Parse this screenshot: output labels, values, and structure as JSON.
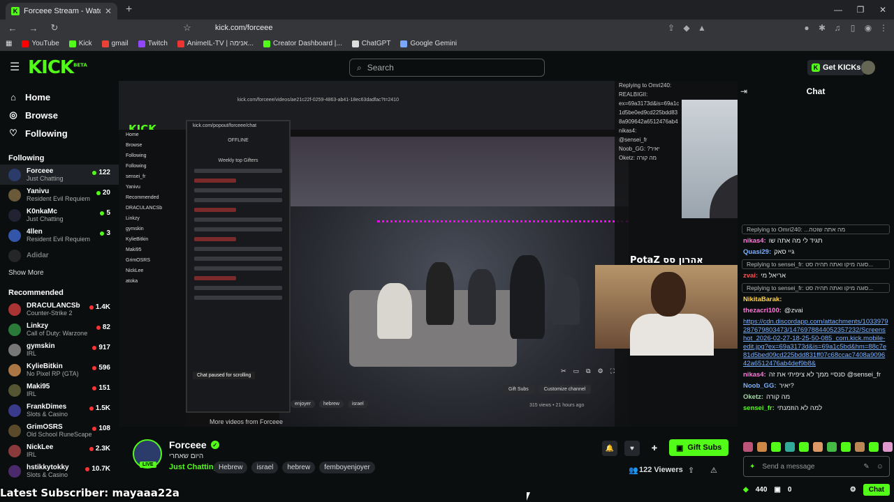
{
  "browser": {
    "tab_title": "Forceee Stream - Watch Live",
    "url": "kick.com/forceee",
    "bookmarks": [
      {
        "label": "YouTube",
        "color": "#f00"
      },
      {
        "label": "Kick",
        "color": "#53fc18"
      },
      {
        "label": "gmail",
        "color": "#ea4335"
      },
      {
        "label": "Twitch",
        "color": "#9146ff"
      },
      {
        "label": "AnimeIL-TV | אנימה...",
        "color": "#e33"
      },
      {
        "label": "Creator Dashboard |...",
        "color": "#53fc18"
      },
      {
        "label": "ChatGPT",
        "color": "#ddd"
      },
      {
        "label": "Google Gemini",
        "color": "#7aa7ff"
      }
    ]
  },
  "header": {
    "logo": "KICK",
    "logo_sup": "BETA",
    "search_placeholder": "Search",
    "get_kicks": "Get KICKs"
  },
  "sidebar": {
    "nav": [
      {
        "label": "Home",
        "icon": "home-icon"
      },
      {
        "label": "Browse",
        "icon": "compass-icon"
      },
      {
        "label": "Following",
        "icon": "heart-icon"
      }
    ],
    "following_title": "Following",
    "following": [
      {
        "name": "Forceee",
        "category": "Just Chatting",
        "viewers": "122",
        "color": "#2b3c6a",
        "selected": true
      },
      {
        "name": "Yanivu",
        "category": "Resident Evil Requiem",
        "viewers": "20",
        "color": "#6a5a3a"
      },
      {
        "name": "K0nkaMc",
        "category": "Just Chatting",
        "viewers": "5",
        "color": "#223"
      },
      {
        "name": "4llen",
        "category": "Resident Evil Requiem",
        "viewers": "3",
        "color": "#3355aa"
      },
      {
        "name": "Adidar",
        "category": "",
        "viewers": "",
        "color": "#444",
        "offline": true
      }
    ],
    "show_more": "Show More",
    "recommended_title": "Recommended",
    "recommended": [
      {
        "name": "DRACULANCSb",
        "category": "Counter-Strike 2",
        "viewers": "1.4K",
        "color": "#a33"
      },
      {
        "name": "Linkzy",
        "category": "Call of Duty: Warzone",
        "viewers": "82",
        "color": "#2a7a3a"
      },
      {
        "name": "gymskin",
        "category": "IRL",
        "viewers": "917",
        "color": "#777"
      },
      {
        "name": "KylieBitkin",
        "category": "No Pixel RP (GTA)",
        "viewers": "596",
        "color": "#aa7744"
      },
      {
        "name": "Maki95",
        "category": "IRL",
        "viewers": "151",
        "color": "#553"
      },
      {
        "name": "FrankDimes",
        "category": "Slots & Casino",
        "viewers": "1.5K",
        "color": "#3a3a8a"
      },
      {
        "name": "GrimOSRS",
        "category": "Old School RuneScape",
        "viewers": "108",
        "color": "#5a4a2a"
      },
      {
        "name": "NickLee",
        "category": "IRL",
        "viewers": "2.3K",
        "color": "#8a3a3a"
      },
      {
        "name": "hstikkytokky",
        "category": "Slots & Casino",
        "viewers": "10.7K",
        "color": "#4a2a6a"
      }
    ]
  },
  "video_inner": {
    "url": "kick.com/forceee/videos/ae21c22f-0259-4863-ab41-18ec63dadfac?t=2410",
    "popout_status": "OFFLINE",
    "weekly": "Weekly top Gifters",
    "paused": "Chat paused for scrolling",
    "overlay_name": "PotaZ אהרון סס",
    "gift_subs": "Gift Subs",
    "customize": "Customize channel",
    "meta": "315 views  •  21 hours ago",
    "more_videos": "More videos from Forceee",
    "tags": [
      "enjoyer",
      "hebrew",
      "israel"
    ]
  },
  "chat": {
    "title": "Chat",
    "messages": [
      {
        "type": "reply",
        "text": "Replying to Omri240: ...מה אתה שוטה"
      },
      {
        "type": "msg",
        "user": "nikas4:",
        "color": "#ff7ad9",
        "text": "תגיד לי מה אתה שו"
      },
      {
        "type": "msg",
        "user": "Quasi29:",
        "color": "#7bb0ff",
        "text": "גיי סאק"
      },
      {
        "type": "reply",
        "text": "Replying to sensei_fr: סוגה מיקו ואתה תהיה סט..."
      },
      {
        "type": "msg",
        "user": "zvai:",
        "color": "#ff5252",
        "text": "אריאל מי"
      },
      {
        "type": "reply",
        "text": "Replying to sensei_fr: סוגה מיקו ואתה תהיה סט..."
      },
      {
        "type": "msg",
        "user": "NikitaBarak:",
        "color": "#ffd54f",
        "text": ""
      },
      {
        "type": "msg",
        "user": "thezacri100:",
        "color": "#ff7ad9",
        "text": "@zvai"
      },
      {
        "type": "link",
        "text": "https://cdn.discordapp.com/attachments/1033979287679803473/1476978844052357232/Screenshot_2026-02-27-18-25-50-085_com.kick.mobile-edit.jpg?ex=69a3173d&is=69a1c5bd&hm=88c7e81d5bed09cd225bdd831ff07c68ccac7408a909642a6512476ab4def9b8&"
      },
      {
        "type": "msg",
        "user": "nikas4:",
        "color": "#ff7ad9",
        "text": "סנסיי ממך לא ציפיתי את זה @sensei_fr"
      },
      {
        "type": "msg",
        "user": "Noob_GG:",
        "color": "#7bb0ff",
        "text": "יאיר?"
      },
      {
        "type": "msg",
        "user": "Oketz:",
        "color": "#a5d6a7",
        "text": "מה קורה"
      },
      {
        "type": "msg",
        "user": "sensei_fr:",
        "color": "#53fc18",
        "text": "למה לא הוזמנתי"
      }
    ],
    "send_placeholder": "Send a message",
    "points": "440",
    "count": "0",
    "send_button": "Chat"
  },
  "stream": {
    "name": "Forceee",
    "title": "היום שאחרי",
    "category": "Just Chatting",
    "tags": [
      "Hebrew",
      "israel",
      "hebrew",
      "femboyenjoyer"
    ],
    "gift_subs": "Gift Subs",
    "viewers": "122 Viewers",
    "live": "LIVE"
  },
  "overlay": {
    "latest_sub": "Latest Subscriber: mayaaa22a"
  }
}
